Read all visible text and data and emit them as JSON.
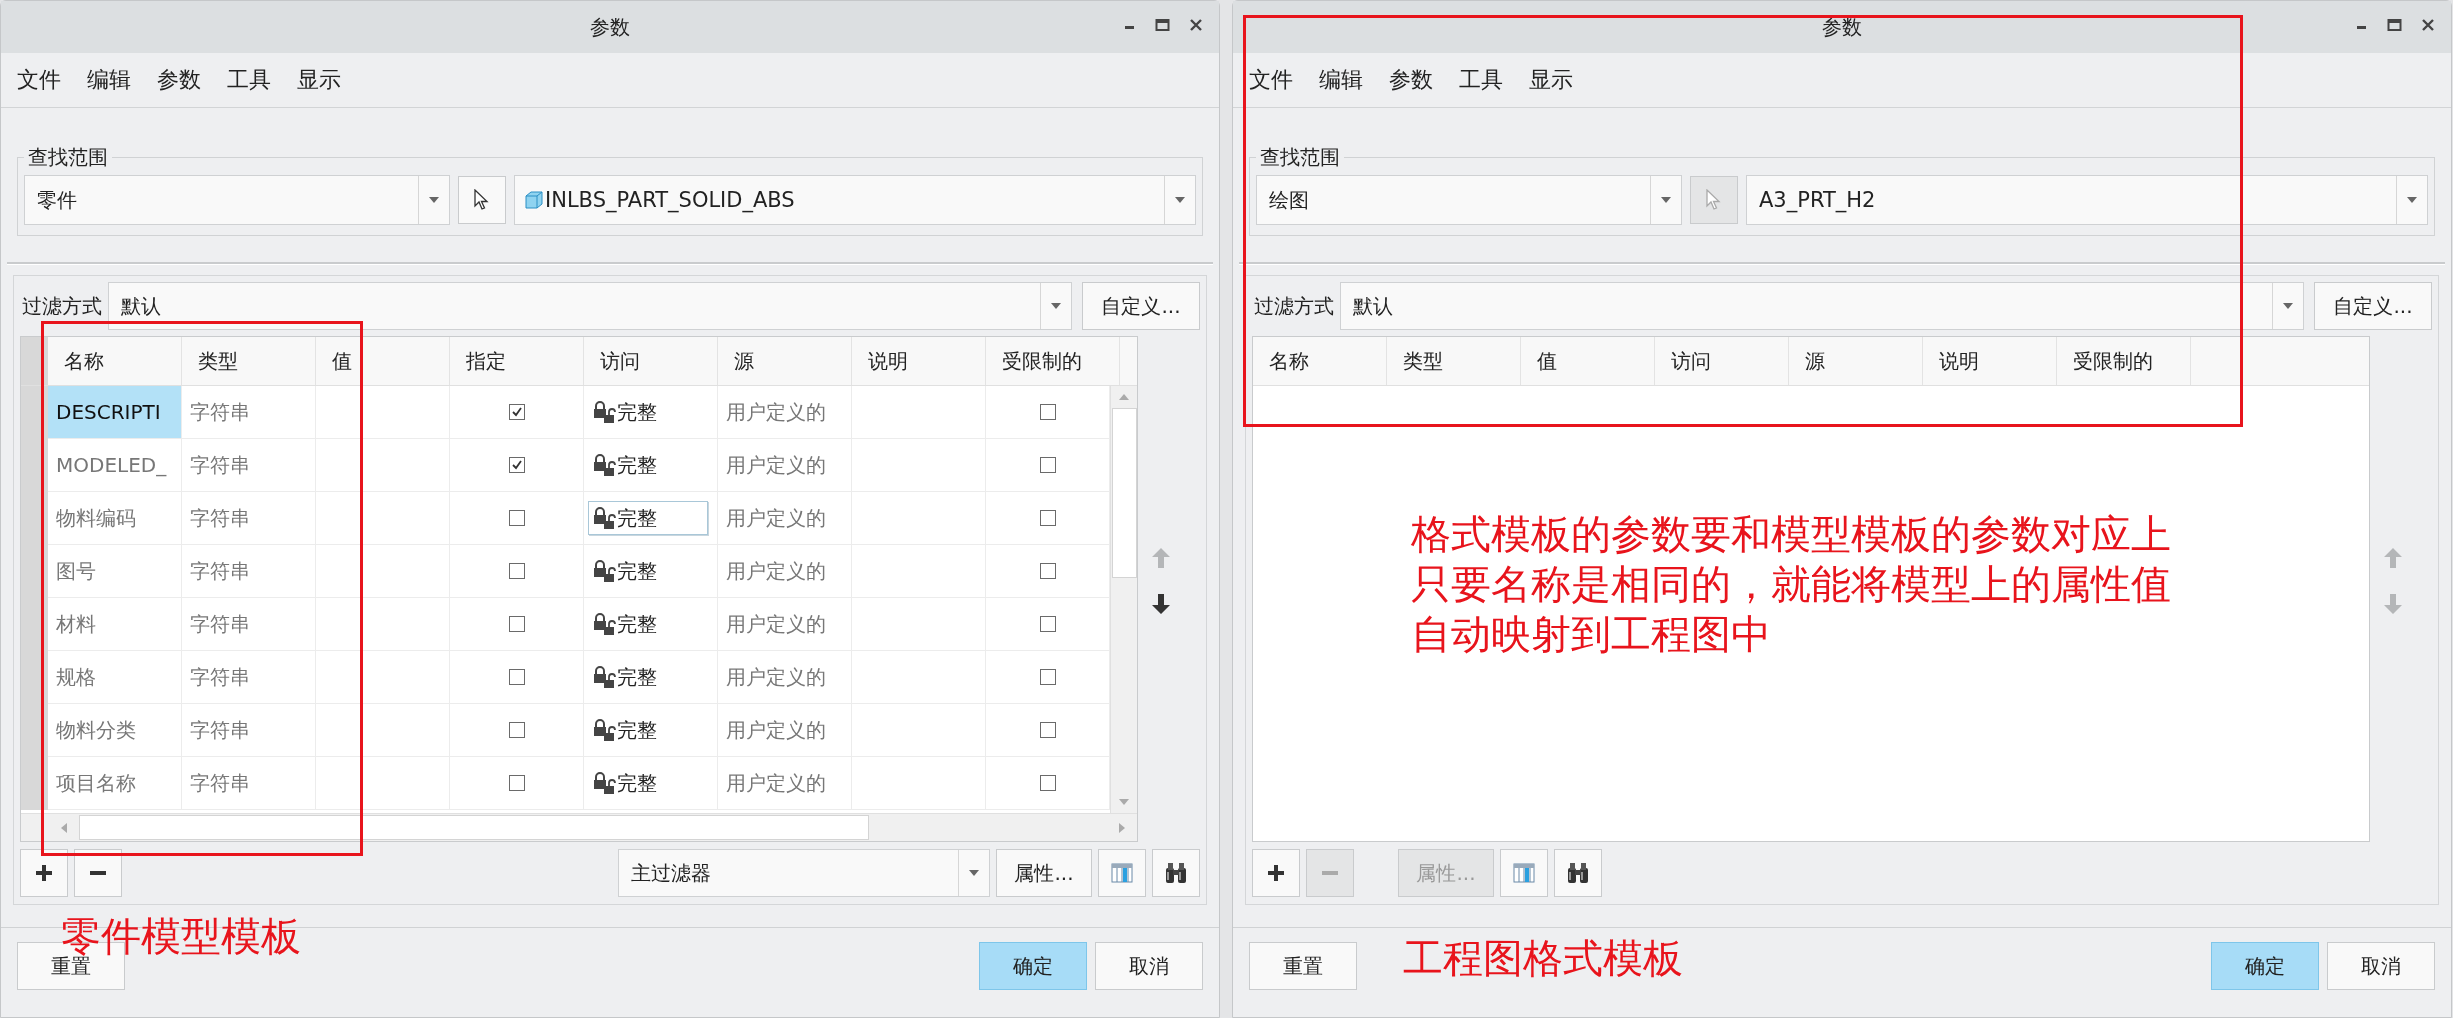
{
  "dialogs": [
    {
      "title": "参数",
      "menu": [
        "文件",
        "编辑",
        "参数",
        "工具",
        "显示"
      ],
      "scope": {
        "legend": "查找范围",
        "type": "零件",
        "pick_disabled": false,
        "model": "INLBS_PART_SOLID_ABS",
        "model_icon": true
      },
      "filter": {
        "label": "过滤方式",
        "value": "默认",
        "button": "自定义..."
      },
      "table": {
        "columns": [
          "名称",
          "类型",
          "值",
          "指定",
          "访问",
          "源",
          "说明",
          "受限制的"
        ],
        "move_up_disabled": true,
        "move_down_disabled": false,
        "rows": [
          {
            "name": "DESCRIPTI",
            "type": "字符串",
            "assigned": true,
            "access": "完整",
            "source": "用户定义的",
            "restricted": false,
            "selected": true,
            "editing": false
          },
          {
            "name": "MODELED_",
            "type": "字符串",
            "assigned": true,
            "access": "完整",
            "source": "用户定义的",
            "restricted": false,
            "selected": false,
            "editing": false
          },
          {
            "name": "物料编码",
            "type": "字符串",
            "assigned": false,
            "access": "完整",
            "source": "用户定义的",
            "restricted": false,
            "selected": false,
            "editing": true
          },
          {
            "name": "图号",
            "type": "字符串",
            "assigned": false,
            "access": "完整",
            "source": "用户定义的",
            "restricted": false,
            "selected": false,
            "editing": false
          },
          {
            "name": "材料",
            "type": "字符串",
            "assigned": false,
            "access": "完整",
            "source": "用户定义的",
            "restricted": false,
            "selected": false,
            "editing": false
          },
          {
            "name": "规格",
            "type": "字符串",
            "assigned": false,
            "access": "完整",
            "source": "用户定义的",
            "restricted": false,
            "selected": false,
            "editing": false
          },
          {
            "name": "物料分类",
            "type": "字符串",
            "assigned": false,
            "access": "完整",
            "source": "用户定义的",
            "restricted": false,
            "selected": false,
            "editing": false
          },
          {
            "name": "项目名称",
            "type": "字符串",
            "assigned": false,
            "access": "完整",
            "source": "用户定义的",
            "restricted": false,
            "selected": false,
            "editing": false
          }
        ]
      },
      "toolbar": {
        "remove_disabled": false,
        "filter_dropdown": "主过滤器",
        "properties": "属性...",
        "properties_disabled": false
      },
      "buttons": {
        "reset": "重置",
        "ok": "确定",
        "cancel": "取消"
      },
      "annotations": [
        {
          "kind": "frame"
        },
        {
          "kind": "label",
          "text": "零件模型模板"
        }
      ]
    },
    {
      "title": "参数",
      "menu": [
        "文件",
        "编辑",
        "参数",
        "工具",
        "显示"
      ],
      "scope": {
        "legend": "查找范围",
        "type": "绘图",
        "pick_disabled": true,
        "model": "A3_PRT_H2"
      },
      "filter": {
        "label": "过滤方式",
        "value": "默认",
        "button": "自定义..."
      },
      "table": {
        "columns": [
          "名称",
          "类型",
          "值",
          "访问",
          "源",
          "说明",
          "受限制的"
        ],
        "move_up_disabled": true,
        "move_down_disabled": true
      },
      "toolbar": {
        "remove_disabled": true,
        "properties": "属性...",
        "properties_disabled": true
      },
      "buttons": {
        "reset": "重置",
        "ok": "确定",
        "cancel": "取消"
      },
      "annotations": [
        {
          "kind": "frame"
        },
        {
          "kind": "note",
          "lines": [
            "格式模板的参数要和模型模板的参数对应上",
            "只要名称是相同的，就能将模型上的属性值",
            "自动映射到工程图中"
          ]
        },
        {
          "kind": "label",
          "text": "工程图格式模板"
        }
      ]
    }
  ]
}
